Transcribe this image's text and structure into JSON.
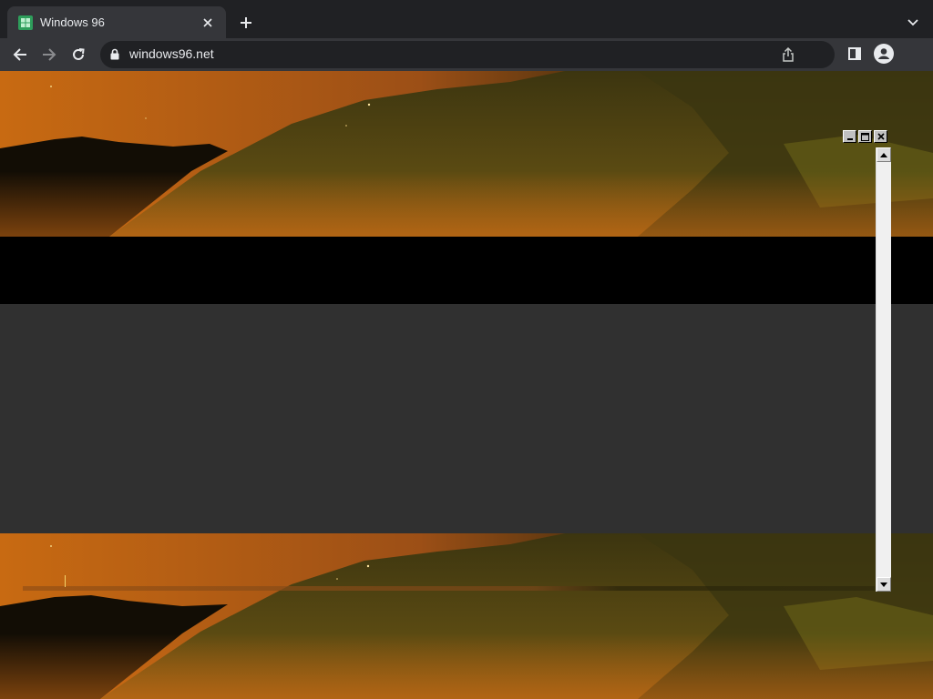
{
  "browser": {
    "tab": {
      "title": "Windows 96",
      "favicon": "windows96-logo-icon",
      "close_icon": "close-icon"
    },
    "toolbar": {
      "url": "windows96.net",
      "back_icon": "arrow-left-icon",
      "forward_icon": "arrow-right-icon",
      "reload_icon": "reload-icon",
      "lock_icon": "lock-icon",
      "share_icon": "share-icon",
      "side_panel_icon": "side-panel-icon",
      "profile_icon": "profile-icon"
    },
    "new_tab_icon": "plus-icon",
    "tab_list_icon": "chevron-down-icon"
  },
  "page": {
    "window_controls": [
      "minimize-icon",
      "maximize-icon",
      "close-icon"
    ],
    "scrollbar_arrows": [
      "arrow-up-icon",
      "arrow-down-icon"
    ]
  },
  "colors": {
    "chrome_bg": "#202124",
    "tab_active": "#35363a",
    "page_gray": "#303030",
    "favicon_green": "#2e9e5b",
    "caret_yellow": "#f3d36b"
  }
}
